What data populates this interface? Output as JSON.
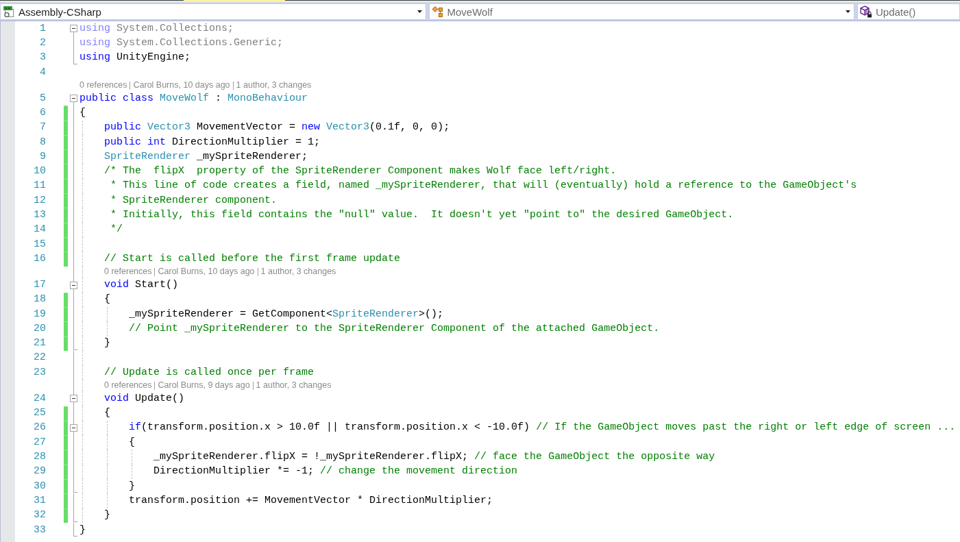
{
  "navigation_bar": {
    "dropdowns": [
      {
        "kind": "project",
        "label": "Assembly-CSharp",
        "caret": true
      },
      {
        "kind": "class",
        "label": "MoveWolf",
        "caret": true
      },
      {
        "kind": "method",
        "label": "Update()",
        "caret": false
      }
    ]
  },
  "editor": {
    "rows": [
      {
        "kind": "code",
        "number": "1",
        "changed": false,
        "fold": {
          "kind": "start",
          "expanded": true
        },
        "tokens": [
          {
            "kind": "dim_keyword",
            "text": "using"
          },
          {
            "kind": "dim",
            "text": " System.Collections;"
          }
        ]
      },
      {
        "kind": "code",
        "number": "2",
        "changed": false,
        "tokens": [
          {
            "kind": "dim_keyword",
            "text": "using"
          },
          {
            "kind": "dim",
            "text": " System.Collections.Generic;"
          }
        ]
      },
      {
        "kind": "code",
        "number": "3",
        "changed": false,
        "fold": {
          "kind": "end"
        },
        "tokens": [
          {
            "kind": "keyword",
            "text": "using"
          },
          {
            "kind": "plain",
            "text": " UnityEngine;"
          }
        ]
      },
      {
        "kind": "code",
        "number": "4",
        "changed": false
      },
      {
        "kind": "codelens",
        "references": "0 references",
        "author": "Carol Burns, 10 days ago",
        "changes": "1 author, 3 changes"
      },
      {
        "kind": "code",
        "number": "5",
        "changed": false,
        "fold": {
          "kind": "start",
          "expanded": true
        },
        "tokens": [
          {
            "kind": "keyword",
            "text": "public class"
          },
          {
            "kind": "type",
            "text": " MoveWolf"
          },
          {
            "kind": "plain",
            "text": " : "
          },
          {
            "kind": "type",
            "text": "MonoBehaviour"
          }
        ]
      },
      {
        "kind": "code",
        "number": "6",
        "changed": true,
        "tokens": [
          {
            "kind": "plain",
            "text": "{"
          }
        ]
      },
      {
        "kind": "code",
        "number": "7",
        "changed": true,
        "tokens": [
          {
            "kind": "keyword",
            "text": "    public"
          },
          {
            "kind": "type",
            "text": " Vector3"
          },
          {
            "kind": "plain",
            "text": " MovementVector = "
          },
          {
            "kind": "keyword",
            "text": "new"
          },
          {
            "kind": "type",
            "text": " Vector3"
          },
          {
            "kind": "plain",
            "text": "(0.1f, 0, 0);"
          }
        ]
      },
      {
        "kind": "code",
        "number": "8",
        "changed": true,
        "tokens": [
          {
            "kind": "keyword",
            "text": "    public int"
          },
          {
            "kind": "plain",
            "text": " DirectionMultiplier = 1;"
          }
        ]
      },
      {
        "kind": "code",
        "number": "9",
        "changed": true,
        "tokens": [
          {
            "kind": "type",
            "text": "    SpriteRenderer"
          },
          {
            "kind": "plain",
            "text": " _mySpriteRenderer;"
          }
        ]
      },
      {
        "kind": "code",
        "number": "10",
        "changed": true,
        "tokens": [
          {
            "kind": "comment",
            "text": "    /* The  flipX  property of the SpriteRenderer Component makes Wolf face left/right."
          }
        ]
      },
      {
        "kind": "code",
        "number": "11",
        "changed": true,
        "tokens": [
          {
            "kind": "comment",
            "text": "     * This line of code creates a field, named _mySpriteRenderer, that will (eventually) hold a reference to the GameObject's"
          }
        ]
      },
      {
        "kind": "code",
        "number": "12",
        "changed": true,
        "tokens": [
          {
            "kind": "comment",
            "text": "     * SpriteRenderer component."
          }
        ]
      },
      {
        "kind": "code",
        "number": "13",
        "changed": true,
        "tokens": [
          {
            "kind": "comment",
            "text": "     * Initially, this field contains the \"null\" value.  It doesn't yet \"point to\" the desired GameObject."
          }
        ]
      },
      {
        "kind": "code",
        "number": "14",
        "changed": true,
        "tokens": [
          {
            "kind": "comment",
            "text": "     */"
          }
        ]
      },
      {
        "kind": "code",
        "number": "15",
        "changed": true
      },
      {
        "kind": "code",
        "number": "16",
        "changed": true,
        "tokens": [
          {
            "kind": "comment",
            "text": "    // Start is called before the first frame update"
          }
        ]
      },
      {
        "kind": "codelens",
        "references": "0 references",
        "author": "Carol Burns, 10 days ago",
        "changes": "1 author, 3 changes"
      },
      {
        "kind": "code",
        "number": "17",
        "changed": false,
        "fold": {
          "kind": "start",
          "expanded": true
        },
        "tokens": [
          {
            "kind": "keyword",
            "text": "    void"
          },
          {
            "kind": "plain",
            "text": " Start()"
          }
        ]
      },
      {
        "kind": "code",
        "number": "18",
        "changed": true,
        "tokens": [
          {
            "kind": "plain",
            "text": "    {"
          }
        ]
      },
      {
        "kind": "code",
        "number": "19",
        "changed": true,
        "tokens": [
          {
            "kind": "plain",
            "text": "        _mySpriteRenderer = GetComponent<"
          },
          {
            "kind": "type",
            "text": "SpriteRenderer"
          },
          {
            "kind": "plain",
            "text": ">();"
          }
        ]
      },
      {
        "kind": "code",
        "number": "20",
        "changed": true,
        "tokens": [
          {
            "kind": "comment",
            "text": "        // Point _mySpriteRenderer to the SpriteRenderer Component of the attached GameObject."
          }
        ]
      },
      {
        "kind": "code",
        "number": "21",
        "changed": true,
        "fold": {
          "kind": "end"
        },
        "tokens": [
          {
            "kind": "plain",
            "text": "    }"
          }
        ]
      },
      {
        "kind": "code",
        "number": "22",
        "changed": false
      },
      {
        "kind": "code",
        "number": "23",
        "changed": false,
        "tokens": [
          {
            "kind": "comment",
            "text": "    // Update is called once per frame"
          }
        ]
      },
      {
        "kind": "codelens",
        "references": "0 references",
        "author": "Carol Burns, 9 days ago",
        "changes": "1 author, 3 changes"
      },
      {
        "kind": "code",
        "number": "24",
        "changed": false,
        "fold": {
          "kind": "start",
          "expanded": true
        },
        "tokens": [
          {
            "kind": "keyword",
            "text": "    void"
          },
          {
            "kind": "plain",
            "text": " Update()"
          }
        ]
      },
      {
        "kind": "code",
        "number": "25",
        "changed": true,
        "tokens": [
          {
            "kind": "plain",
            "text": "    {"
          }
        ]
      },
      {
        "kind": "code",
        "number": "26",
        "changed": true,
        "fold": {
          "kind": "start",
          "expanded": true
        },
        "tokens": [
          {
            "kind": "keyword",
            "text": "        if"
          },
          {
            "kind": "plain",
            "text": "(transform.position.x > 10.0f || transform.position.x < -10.0f) "
          },
          {
            "kind": "comment",
            "text": "// If the GameObject moves past the right or left edge of screen ..."
          }
        ]
      },
      {
        "kind": "code",
        "number": "27",
        "changed": true,
        "tokens": [
          {
            "kind": "plain",
            "text": "        {"
          }
        ]
      },
      {
        "kind": "code",
        "number": "28",
        "changed": true,
        "tokens": [
          {
            "kind": "plain",
            "text": "            _mySpriteRenderer.flipX = !_mySpriteRenderer.flipX; "
          },
          {
            "kind": "comment",
            "text": "// face the GameObject the opposite way"
          }
        ]
      },
      {
        "kind": "code",
        "number": "29",
        "changed": true,
        "tokens": [
          {
            "kind": "plain",
            "text": "            DirectionMultiplier *= -1; "
          },
          {
            "kind": "comment",
            "text": "// change the movement direction"
          }
        ]
      },
      {
        "kind": "code",
        "number": "30",
        "changed": true,
        "fold": {
          "kind": "end"
        },
        "tokens": [
          {
            "kind": "plain",
            "text": "        }"
          }
        ]
      },
      {
        "kind": "code",
        "number": "31",
        "changed": true,
        "tokens": [
          {
            "kind": "plain",
            "text": "        transform.position += MovementVector * DirectionMultiplier;"
          }
        ]
      },
      {
        "kind": "code",
        "number": "32",
        "changed": true,
        "fold": {
          "kind": "end"
        },
        "tokens": [
          {
            "kind": "plain",
            "text": "    }"
          }
        ]
      },
      {
        "kind": "code",
        "number": "33",
        "changed": false,
        "fold": {
          "kind": "end"
        },
        "tokens": [
          {
            "kind": "plain",
            "text": "}"
          }
        ]
      }
    ]
  }
}
